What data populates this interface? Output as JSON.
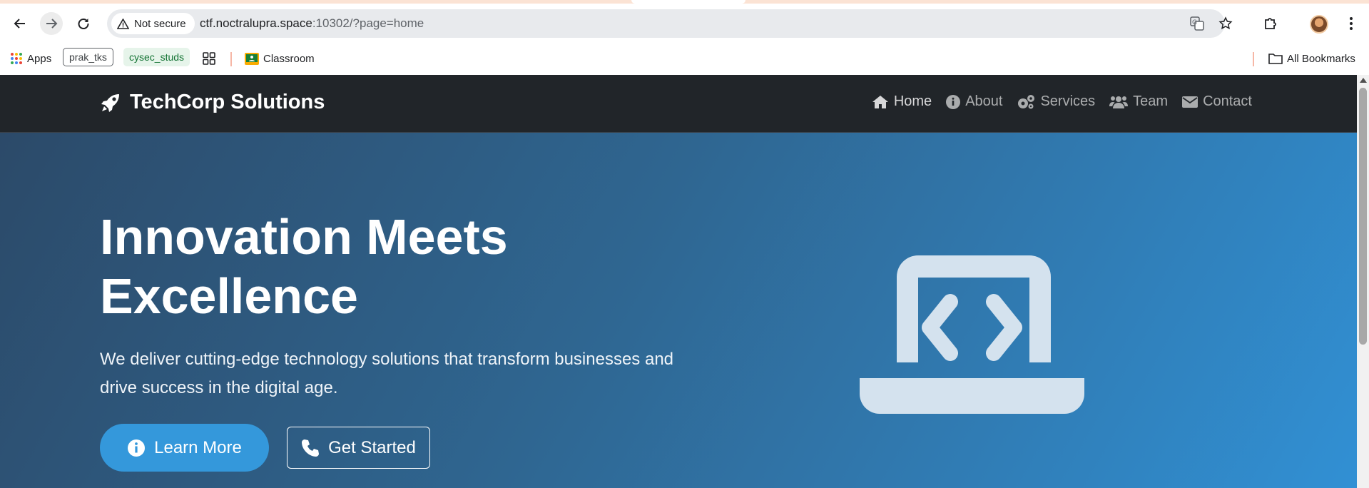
{
  "browser": {
    "security_label": "Not secure",
    "url_host": "ctf.noctralupra.space",
    "url_rest": ":10302/?page=home",
    "bookmarks": {
      "apps": "Apps",
      "prak": "prak_tks",
      "cysec": "cysec_studs",
      "classroom": "Classroom",
      "all": "All Bookmarks"
    }
  },
  "site": {
    "brand": "TechCorp Solutions",
    "nav": [
      {
        "label": "Home",
        "icon": "home-icon"
      },
      {
        "label": "About",
        "icon": "info-icon"
      },
      {
        "label": "Services",
        "icon": "gears-icon"
      },
      {
        "label": "Team",
        "icon": "users-icon"
      },
      {
        "label": "Contact",
        "icon": "envelope-icon"
      }
    ],
    "hero": {
      "title_line1": "Innovation Meets",
      "title_line2": "Excellence",
      "subtitle": "We deliver cutting-edge technology solutions that transform businesses and drive success in the digital age.",
      "primary_button": "Learn More",
      "secondary_button": "Get Started",
      "illustration_icon": "laptop-code-icon"
    }
  },
  "colors": {
    "navbar": "#212529",
    "hero_start": "#2c4a69",
    "hero_end": "#3190d4",
    "accent": "#3498db"
  }
}
